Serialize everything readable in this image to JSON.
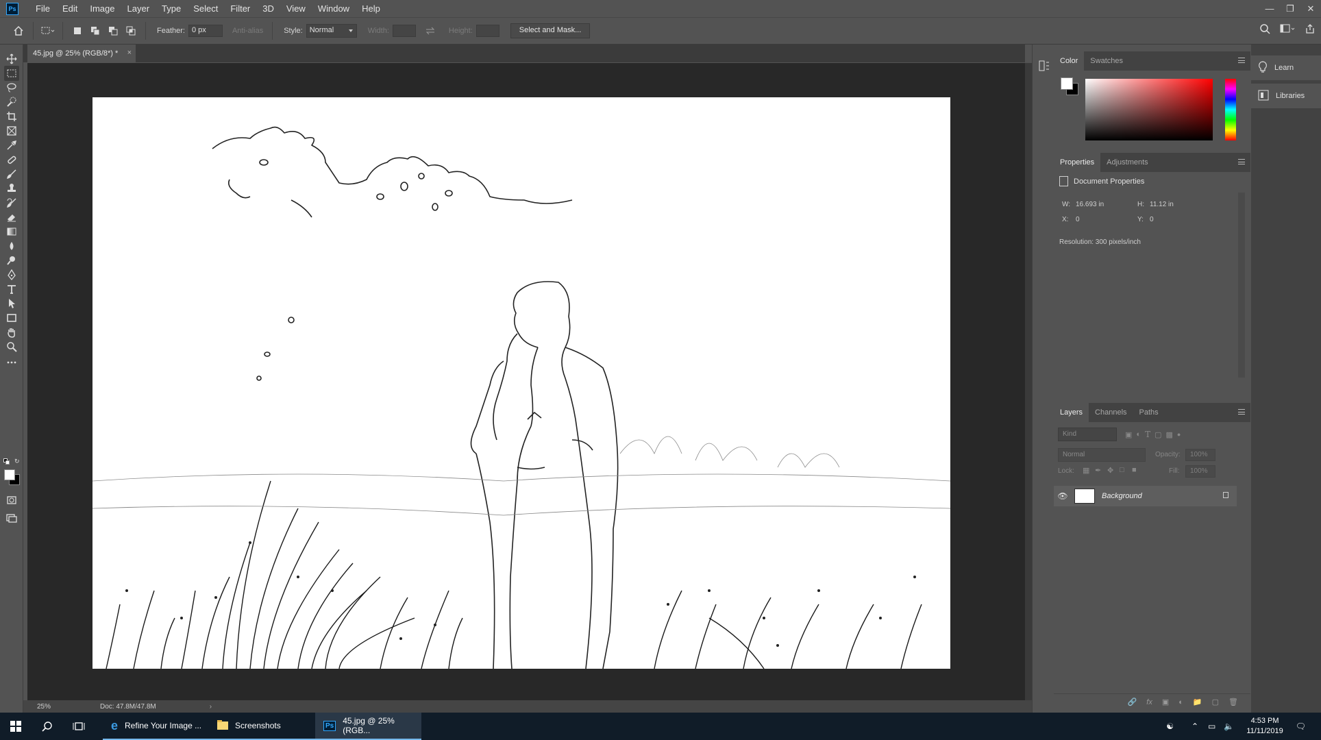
{
  "menu": {
    "app_icon": "Ps",
    "items": [
      "File",
      "Edit",
      "Image",
      "Layer",
      "Type",
      "Select",
      "Filter",
      "3D",
      "View",
      "Window",
      "Help"
    ]
  },
  "options": {
    "feather_label": "Feather:",
    "feather_value": "0 px",
    "antialias_label": "Anti-alias",
    "style_label": "Style:",
    "style_value": "Normal",
    "width_label": "Width:",
    "height_label": "Height:",
    "select_mask_label": "Select and Mask..."
  },
  "document": {
    "tab_title": "45.jpg @ 25% (RGB/8*) *",
    "close_label": "×"
  },
  "status": {
    "zoom": "25%",
    "doc_size": "Doc: 47.8M/47.8M"
  },
  "color_panel": {
    "tabs": [
      "Color",
      "Swatches"
    ],
    "foreground": "#ffffff",
    "background": "#000000"
  },
  "properties_panel": {
    "tabs": [
      "Properties",
      "Adjustments"
    ],
    "header": "Document Properties",
    "w_label": "W:",
    "w_value": "16.693 in",
    "h_label": "H:",
    "h_value": "11.12 in",
    "x_label": "X:",
    "x_value": "0",
    "y_label": "Y:",
    "y_value": "0",
    "resolution": "Resolution: 300 pixels/inch"
  },
  "layers_panel": {
    "tabs": [
      "Layers",
      "Channels",
      "Paths"
    ],
    "kind_placeholder": "Kind",
    "blend_mode": "Normal",
    "opacity_label": "Opacity:",
    "opacity_value": "100%",
    "lock_label": "Lock:",
    "fill_label": "Fill:",
    "fill_value": "100%",
    "layers": [
      {
        "name": "Background",
        "visible": true,
        "locked": true
      }
    ]
  },
  "side_dock": {
    "learn_label": "Learn",
    "libraries_label": "Libraries"
  },
  "taskbar": {
    "apps": [
      {
        "label": "Refine Your Image ..."
      },
      {
        "label": "Screenshots"
      },
      {
        "label": "45.jpg @ 25% (RGB..."
      }
    ],
    "time": "4:53 PM",
    "date": "11/11/2019"
  }
}
